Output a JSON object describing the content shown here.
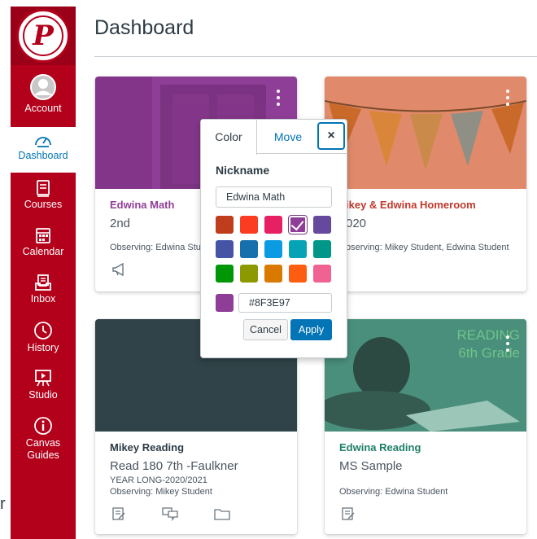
{
  "page": {
    "title": "Dashboard"
  },
  "logo": {
    "letter": "P"
  },
  "sidebar": {
    "items": [
      {
        "label": "Account",
        "icon": "avatar-icon",
        "active": false
      },
      {
        "label": "Dashboard",
        "icon": "speedometer-icon",
        "active": true
      },
      {
        "label": "Courses",
        "icon": "book-icon",
        "active": false
      },
      {
        "label": "Calendar",
        "icon": "calendar-icon",
        "active": false
      },
      {
        "label": "Inbox",
        "icon": "inbox-icon",
        "active": false
      },
      {
        "label": "History",
        "icon": "clock-icon",
        "active": false
      },
      {
        "label": "Studio",
        "icon": "studio-icon",
        "active": false
      },
      {
        "label": "Canvas\nGuides",
        "label_line1": "Canvas",
        "label_line2": "Guides",
        "icon": "info-icon",
        "active": false
      }
    ]
  },
  "cards": [
    {
      "name": "Edwina Math",
      "term": "2nd",
      "observing": "Observing: Edwina Stud",
      "color": "#8F3E97",
      "name_color": "#8f3e97",
      "icons": [
        "announcement-icon"
      ]
    },
    {
      "name": "ikey & Edwina Homeroom",
      "term": "020",
      "observing": "bserving: Mikey Student, Edwina Student",
      "color": "#e08a6b",
      "name_color": "#c0392b",
      "icons": []
    },
    {
      "name": "Mikey Reading",
      "term": "Read 180 7th -Faulkner",
      "subterm": "YEAR LONG-2020/2021",
      "observing": "Observing: Mikey Student",
      "color": "#2f4348",
      "name_color": "#2d3b45",
      "icons": [
        "assignment-icon",
        "discussion-icon",
        "folder-icon"
      ]
    },
    {
      "name": "Edwina Reading",
      "term": "MS Sample",
      "observing": "Observing: Edwina Student",
      "color": "#3d8b78",
      "name_color": "#1f7f66",
      "hero_text_1": "READING",
      "hero_text_2": "6th Grade",
      "icons": [
        "assignment-icon"
      ]
    }
  ],
  "popover": {
    "tab_color": "Color",
    "tab_move": "Move",
    "close_label": "×",
    "nickname_label": "Nickname",
    "nickname_value": "Edwina Math",
    "swatches": [
      "#bf3d1d",
      "#fb3b22",
      "#e71f63",
      "#8f3e97",
      "#65499d",
      "#4554a4",
      "#1770ab",
      "#0b9be3",
      "#06a3b7",
      "#009688",
      "#009606",
      "#8d9900",
      "#d97900",
      "#fd5d10",
      "#f06291"
    ],
    "selected_swatch": "#8f3e97",
    "hex_value": "#8F3E97",
    "cancel_label": "Cancel",
    "apply_label": "Apply"
  },
  "stray_text": "r",
  "colors": {
    "nav": "#b3001b",
    "link": "#0374b5",
    "text": "#2d3b45"
  }
}
